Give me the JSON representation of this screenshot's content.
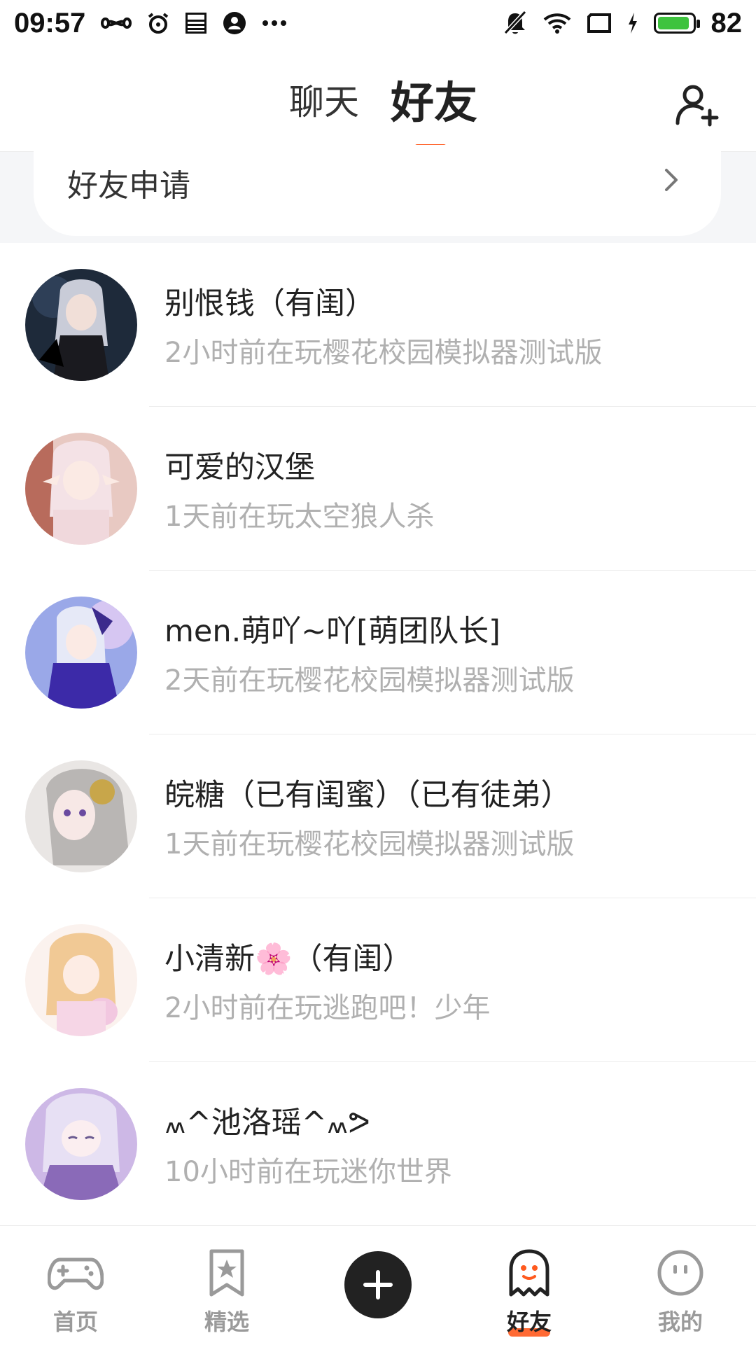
{
  "status_bar": {
    "time": "09:57",
    "battery_level": "82",
    "icons_left": [
      "infinity-icon",
      "alarm-icon",
      "news-icon",
      "account-icon",
      "more-icon"
    ],
    "icons_right": [
      "mute-icon",
      "wifi-icon",
      "screen-icon",
      "charging-icon",
      "battery-icon"
    ]
  },
  "header": {
    "tabs": [
      {
        "label": "聊天",
        "active": false
      },
      {
        "label": "好友",
        "active": true
      }
    ],
    "accent_color": "#ff5a1e"
  },
  "friend_request": {
    "label": "好友申请"
  },
  "friends": [
    {
      "name": "别恨钱（有闺）",
      "status": "2小时前在玩樱花校园模拟器测试版"
    },
    {
      "name": "可爱的汉堡",
      "status": "1天前在玩太空狼人杀"
    },
    {
      "name": "men.萌吖~吖[萌团队长]",
      "status": "2天前在玩樱花校园模拟器测试版"
    },
    {
      "name": "皖糖（已有闺蜜）（已有徒弟）",
      "status": "1天前在玩樱花校园模拟器测试版"
    },
    {
      "name": "小清新🌸（有闺）",
      "status": "2小时前在玩逃跑吧！少年"
    },
    {
      "name": "៳^池洛瑶^៳ᕗ",
      "status": "10小时前在玩迷你世界"
    }
  ],
  "bottom_nav": {
    "items": [
      {
        "label": "首页",
        "icon": "gamepad-icon",
        "active": false
      },
      {
        "label": "精选",
        "icon": "star-bookmark-icon",
        "active": false
      },
      {
        "label": "",
        "icon": "plus-icon",
        "active": false
      },
      {
        "label": "好友",
        "icon": "ghost-icon",
        "active": true
      },
      {
        "label": "我的",
        "icon": "face-icon",
        "active": false
      }
    ]
  }
}
